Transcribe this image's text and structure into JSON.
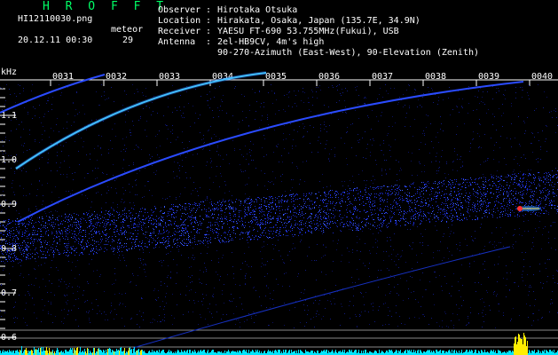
{
  "app_title": "H R O F F T",
  "header": {
    "filename": "HI12110030.png",
    "datetime": "20.12.11 00:30",
    "meteor_label": "meteor",
    "meteor_count": "29"
  },
  "info_rows": [
    {
      "label": "Observer",
      "value": "Hirotaka Otsuka"
    },
    {
      "label": "Location",
      "value": "Hirakata, Osaka, Japan (135.7E, 34.9N)"
    },
    {
      "label": "Receiver",
      "value": "YAESU FT-690 53.755MHz(Fukui), USB"
    },
    {
      "label": "Antenna",
      "value": "2el-HB9CV, 4m's high"
    },
    {
      "label": "",
      "value": "90-270-Azimuth (East-West), 90-Elevation (Zenith)"
    }
  ],
  "y_unit": "kHz",
  "y_ticks": [
    "1.1",
    "1.0",
    "0.9",
    "0.8",
    "0.7",
    "0.6"
  ],
  "x_ticks": [
    "0031",
    "0032",
    "0033",
    "0034",
    "0035",
    "0036",
    "0037",
    "0038",
    "0039",
    "0040"
  ],
  "colors": {
    "title": "#00ff66",
    "axis": "#ffffff",
    "trace_blue": "#2a4bff",
    "trace_cyan": "#4de8ff",
    "noise": "#1a2ad0",
    "bottom_cyan": "#00e5ff",
    "bottom_yellow": "#ffee00",
    "meteor_echo": "#ff3030"
  }
}
